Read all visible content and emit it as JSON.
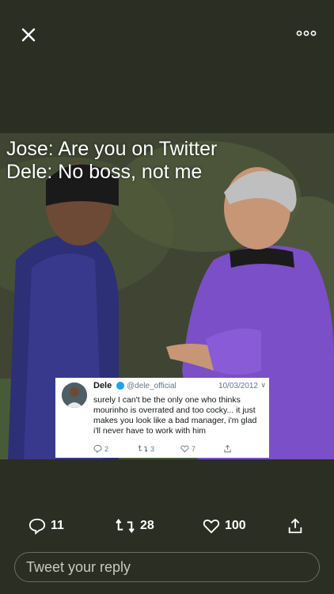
{
  "topbar": {
    "close_icon": "close-icon",
    "more_icon": "more-icon"
  },
  "meme": {
    "caption_line1": "Jose: Are you on Twitter",
    "caption_line2": "Dele: No boss, not me"
  },
  "embedded_tweet": {
    "name": "Dele",
    "handle": "@dele_official",
    "date": "10/03/2012",
    "text": "surely I can't be the only one who thinks mourinho is overrated and too cocky... it just makes you look like a bad manager, i'm glad i'll never have to work with him",
    "replies": "2",
    "retweets": "3",
    "likes": "7"
  },
  "actions": {
    "replies": "11",
    "retweets": "28",
    "likes": "100"
  },
  "reply_box": {
    "placeholder": "Tweet your reply"
  },
  "colors": {
    "background": "#2b2e22",
    "verified": "#1da1f2"
  }
}
